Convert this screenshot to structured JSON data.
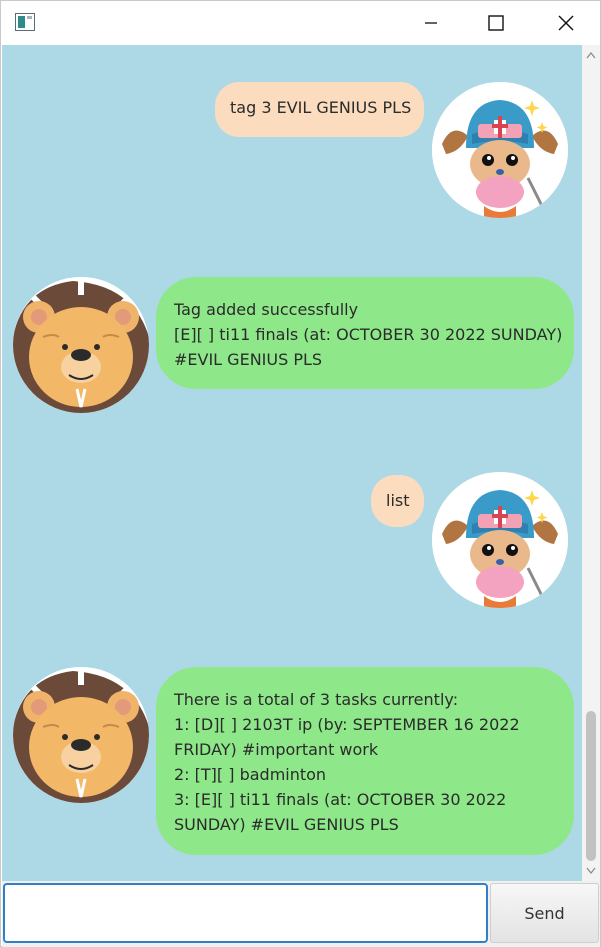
{
  "window": {
    "controls": {
      "minimize_icon": "minimize-icon",
      "maximize_icon": "maximize-icon",
      "close_icon": "close-icon"
    }
  },
  "colors": {
    "chat_background": "#add8e6",
    "user_bubble": "#fbdcbf",
    "bot_bubble": "#8ee88a",
    "input_border": "#2f7fc9"
  },
  "messages": [
    {
      "sender": "user",
      "lines": [
        "tag 3 EVIL GENIUS PLS"
      ]
    },
    {
      "sender": "bot",
      "lines": [
        "Tag added successfully",
        "[E][ ] ti11 finals (at: OCTOBER 30 2022 SUNDAY)",
        "#EVIL GENIUS PLS"
      ]
    },
    {
      "sender": "user",
      "lines": [
        "list"
      ]
    },
    {
      "sender": "bot",
      "lines": [
        "There is a total of 3 tasks currently:",
        "1: [D][ ] 2103T ip (by: SEPTEMBER 16 2022",
        "FRIDAY) #important work",
        "2: [T][ ] badminton",
        "3: [E][ ] ti11 finals (at: OCTOBER 30 2022",
        "SUNDAY) #EVIL GENIUS PLS"
      ]
    }
  ],
  "input": {
    "value": "",
    "placeholder": ""
  },
  "send_button": {
    "label": "Send"
  }
}
